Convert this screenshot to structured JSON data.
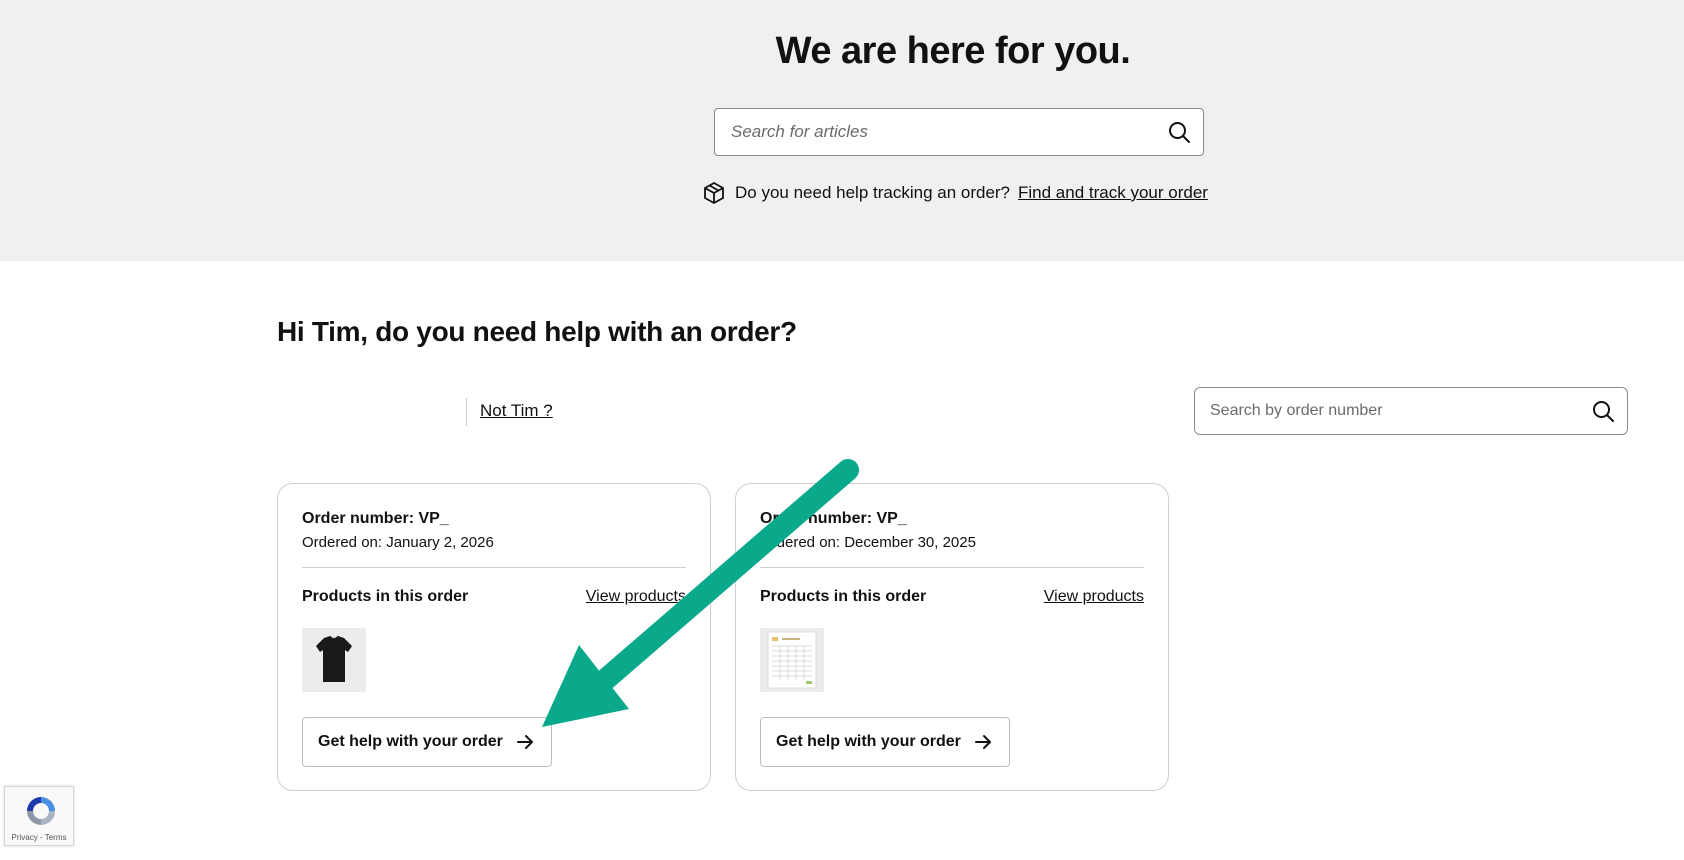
{
  "hero": {
    "title": "We are here for you.",
    "search_placeholder": "Search for articles",
    "track_text": "Do you need help tracking an order?",
    "track_link": "Find and track your order"
  },
  "orders_section": {
    "greeting": "Hi Tim, do you need help with an order?",
    "not_user_link": "Not Tim ?",
    "search_placeholder": "Search by order number"
  },
  "orders": [
    {
      "order_number": "Order number: VP_",
      "ordered_on": "Ordered on: January 2, 2026",
      "products_heading": "Products in this order",
      "view_products": "View products",
      "product_thumb": "black-tshirt",
      "help_button": "Get help with your order"
    },
    {
      "order_number": "Order number: VP_",
      "ordered_on": "Ordered on: December 30, 2025",
      "products_heading": "Products in this order",
      "view_products": "View products",
      "product_thumb": "printed-schedule-sheet",
      "help_button": "Get help with your order"
    }
  ],
  "annotation": {
    "arrow_color": "#0aa98b"
  },
  "recaptcha": {
    "links": "Privacy - Terms"
  }
}
